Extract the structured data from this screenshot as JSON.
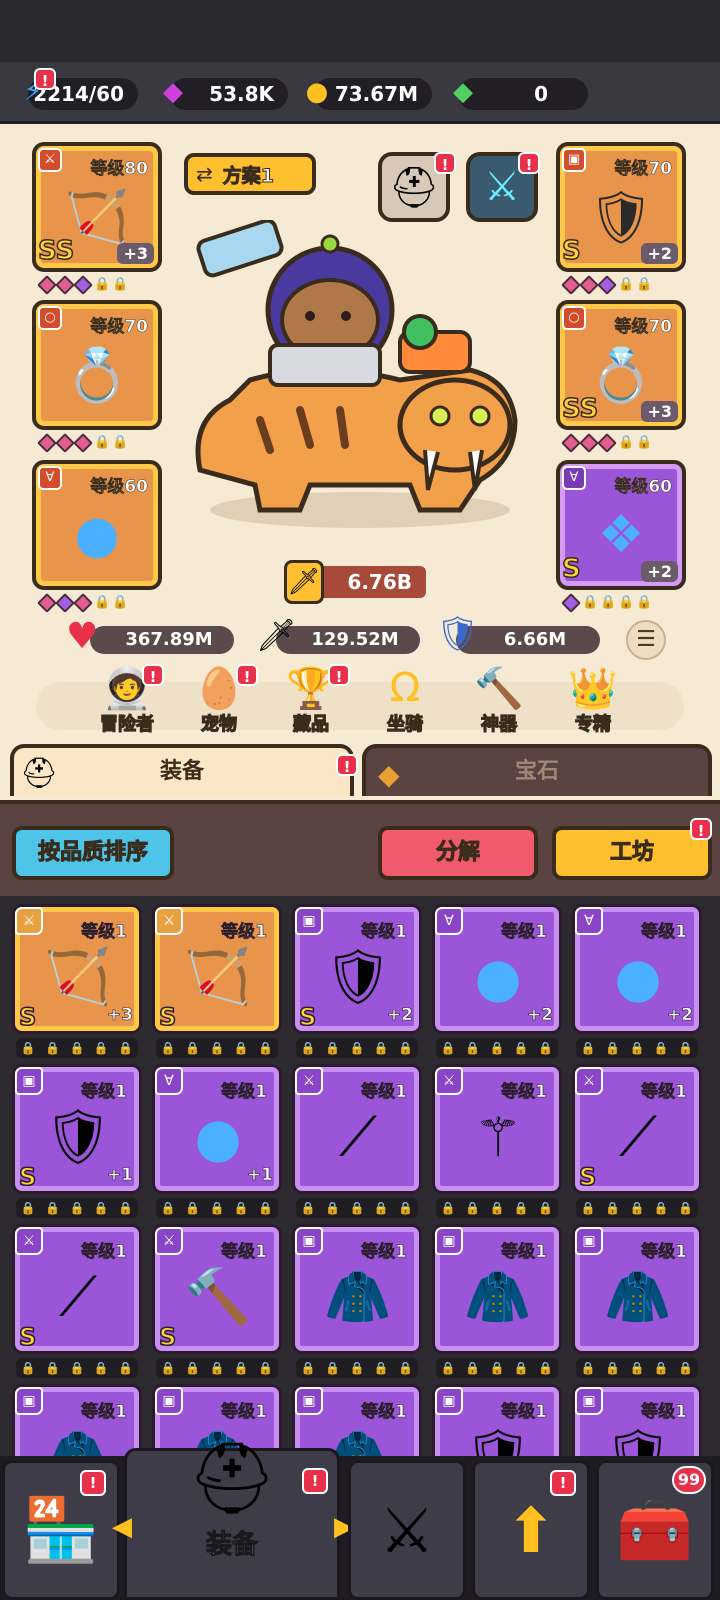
{
  "resources": {
    "energy": "2214/60",
    "gems": "53.8K",
    "coins": "73.67M",
    "crystals": "0"
  },
  "hero": {
    "loadout_label": "方案1",
    "power": "6.76B",
    "stats": {
      "hp": "367.89M",
      "attack": "129.52M",
      "defense": "6.66M"
    },
    "left_slots": [
      {
        "level": "等级80",
        "tier": "SS",
        "plus": "+3",
        "icon": "bow-icon"
      },
      {
        "level": "等级70",
        "tier": "",
        "plus": "",
        "icon": "ring-icon"
      },
      {
        "level": "等级60",
        "tier": "",
        "plus": "",
        "icon": "orb-necklace-icon"
      }
    ],
    "right_slots": [
      {
        "level": "等级70",
        "tier": "S",
        "plus": "+2",
        "icon": "armor-icon"
      },
      {
        "level": "等级70",
        "tier": "SS",
        "plus": "+3",
        "icon": "ring-icon"
      },
      {
        "level": "等级60",
        "tier": "S",
        "plus": "+2",
        "icon": "winged-amulet-icon"
      }
    ]
  },
  "menu": [
    {
      "label": "冒险者",
      "icon": "adventurer-icon"
    },
    {
      "label": "宠物",
      "icon": "pet-egg-icon"
    },
    {
      "label": "藏品",
      "icon": "collection-icon"
    },
    {
      "label": "坐骑",
      "icon": "mount-horseshoe-icon"
    },
    {
      "label": "神器",
      "icon": "artifact-hammer-icon"
    },
    {
      "label": "专精",
      "icon": "mastery-crown-icon"
    }
  ],
  "tabs": {
    "equipment": "装备",
    "gems": "宝石"
  },
  "actions": {
    "sort": "按品质排序",
    "dismantle": "分解",
    "workshop": "工坊"
  },
  "inventory": [
    {
      "level": "等级1",
      "tier": "S",
      "plus": "+3",
      "rarity": "o",
      "icon": "bow-icon"
    },
    {
      "level": "等级1",
      "tier": "S",
      "plus": "",
      "rarity": "o",
      "icon": "bow-icon"
    },
    {
      "level": "等级1",
      "tier": "S",
      "plus": "+2",
      "rarity": "p",
      "icon": "armor-icon"
    },
    {
      "level": "等级1",
      "tier": "",
      "plus": "+2",
      "rarity": "p",
      "icon": "orb-necklace-icon"
    },
    {
      "level": "等级1",
      "tier": "",
      "plus": "+2",
      "rarity": "p",
      "icon": "orb-necklace-icon"
    },
    {
      "level": "等级1",
      "tier": "S",
      "plus": "+1",
      "rarity": "p",
      "icon": "armor-icon"
    },
    {
      "level": "等级1",
      "tier": "",
      "plus": "+1",
      "rarity": "p",
      "icon": "orb-necklace-icon"
    },
    {
      "level": "等级1",
      "tier": "",
      "plus": "",
      "rarity": "p",
      "icon": "spear-icon"
    },
    {
      "level": "等级1",
      "tier": "",
      "plus": "",
      "rarity": "p",
      "icon": "staff-icon"
    },
    {
      "level": "等级1",
      "tier": "S",
      "plus": "",
      "rarity": "p",
      "icon": "spear-icon"
    },
    {
      "level": "等级1",
      "tier": "S",
      "plus": "",
      "rarity": "p",
      "icon": "spear-icon"
    },
    {
      "level": "等级1",
      "tier": "S",
      "plus": "",
      "rarity": "p",
      "icon": "mace-icon"
    },
    {
      "level": "等级1",
      "tier": "",
      "plus": "",
      "rarity": "p",
      "icon": "fur-armor-icon"
    },
    {
      "level": "等级1",
      "tier": "",
      "plus": "",
      "rarity": "p",
      "icon": "fur-armor-icon"
    },
    {
      "level": "等级1",
      "tier": "",
      "plus": "",
      "rarity": "p",
      "icon": "fur-armor-icon"
    },
    {
      "level": "等级1",
      "tier": "",
      "plus": "",
      "rarity": "p",
      "icon": "fur-armor-icon"
    },
    {
      "level": "等级1",
      "tier": "",
      "plus": "",
      "rarity": "p",
      "icon": "fur-armor-icon"
    },
    {
      "level": "等级1",
      "tier": "",
      "plus": "",
      "rarity": "p",
      "icon": "fur-armor-icon"
    },
    {
      "level": "等级1",
      "tier": "",
      "plus": "",
      "rarity": "p",
      "icon": "plate-armor-icon"
    },
    {
      "level": "等级1",
      "tier": "",
      "plus": "",
      "rarity": "p",
      "icon": "plate-armor-icon"
    }
  ],
  "nav": {
    "active_label": "装备",
    "chest_count": "99",
    "badges": {
      "notice": "!"
    }
  },
  "colors": {
    "accent_orange": "#ffc847",
    "rarity_purple": "#9a55d8",
    "rarity_orange": "#e8944a",
    "alert_red": "#e8304a",
    "tab_active": "#fbe6c6",
    "sort_button": "#4ec4e8",
    "dismantle_button": "#f05a6a",
    "workshop_button": "#ffc030"
  }
}
